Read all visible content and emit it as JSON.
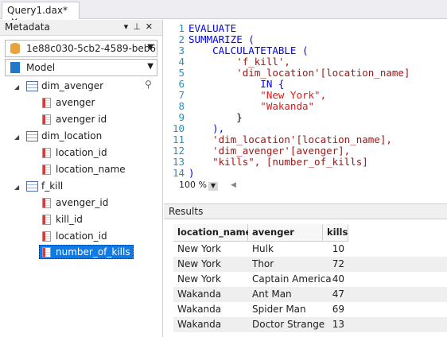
{
  "tab": {
    "title": "Query1.dax*",
    "close": "✕"
  },
  "metadata": {
    "title": "Metadata",
    "server": "1e88c030-5cb2-4589-beb6",
    "model": "Model",
    "tree": [
      {
        "name": "dim_avenger",
        "columns": [
          "avenger",
          "avenger id"
        ]
      },
      {
        "name": "dim_location",
        "columns": [
          "location_id",
          "location_name"
        ]
      },
      {
        "name": "f_kill",
        "columns": [
          "avenger_id",
          "kill_id",
          "location_id",
          "number_of_kills"
        ]
      }
    ]
  },
  "editor": {
    "lines": [
      "EVALUATE",
      "SUMMARIZE (",
      "    CALCULATETABLE (",
      "        'f_kill',",
      "        'dim_location'[location_name]",
      "            IN {",
      "            \"New York\",",
      "            \"Wakanda\"",
      "        }",
      "    ),",
      "    'dim_location'[location_name],",
      "    'dim_avenger'[avenger],",
      "    \"kills\", [number_of_kills]",
      ")"
    ],
    "zoom": "100 %"
  },
  "results": {
    "title": "Results",
    "columns": [
      "location_name",
      "avenger",
      "kills"
    ],
    "rows": [
      [
        "New York",
        "Hulk",
        "10"
      ],
      [
        "New York",
        "Thor",
        "72"
      ],
      [
        "New York",
        "Captain America",
        "40"
      ],
      [
        "Wakanda",
        "Ant Man",
        "47"
      ],
      [
        "Wakanda",
        "Spider Man",
        "69"
      ],
      [
        "Wakanda",
        "Doctor Strange",
        "13"
      ]
    ]
  },
  "colors": {
    "keyword": "#0000ff",
    "string": "#a31515",
    "line_number": "#2b91af",
    "selection": "#0f7ae5"
  },
  "icons": [
    "close-icon",
    "dropdown-icon",
    "pin-icon",
    "database-icon",
    "cube-icon",
    "table-icon",
    "column-icon",
    "search-icon"
  ]
}
